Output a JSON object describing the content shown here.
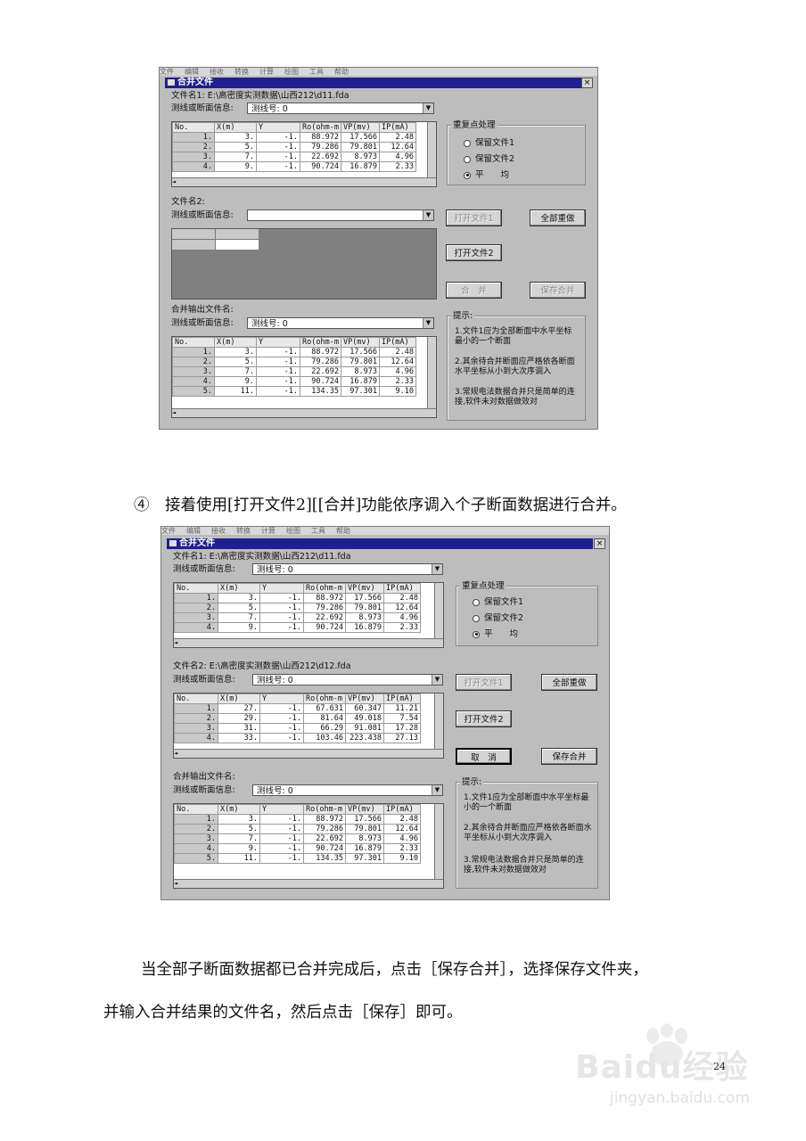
{
  "menu": [
    "文件",
    "编辑",
    "接收",
    "转换",
    "计算",
    "绘图",
    "工具",
    "帮助"
  ],
  "dialog": {
    "title": "合并文件",
    "close": "×",
    "file1_label_a": "文件名1: E:\\高密度实测数据\\山西212\\d11.fda",
    "line_info_label": "测线或断面信息:",
    "line_no": "测线号: 0",
    "file2_label_a": "文件名2:",
    "file2_label_b": "文件名2: E:\\高密度实测数据\\山西212\\d12.fda",
    "output_label": "合并输出文件名:",
    "group_title": "重复点处理",
    "radio_keep1": "保留文件1",
    "radio_keep2": "保留文件2",
    "radio_avg": "平　　均",
    "btn_open1": "打开文件1",
    "btn_redo": "全部重做",
    "btn_open2": "打开文件2",
    "btn_merge": "合　并",
    "btn_cancel": "取　消",
    "btn_save": "保存合并",
    "hint_title": "提示:",
    "hint1": "1.文件1应为全部断面中水平坐标最小的一个断面",
    "hint2": "2.其余待合并断面应严格依各断面水平坐标从小到大次序调入",
    "hint3": "3.常规电法数据合并只是简单的连接,软件未对数据做效对"
  },
  "grid_headers": [
    "No.",
    "X(m)",
    "Y",
    "Ro(ohm-m",
    "VP(mv)",
    "IP(mA)"
  ],
  "grid1_rows": [
    [
      "1.",
      "3.",
      "-1.",
      "88.972",
      "17.566",
      "2.48"
    ],
    [
      "2.",
      "5.",
      "-1.",
      "79.286",
      "79.801",
      "12.64"
    ],
    [
      "3.",
      "7.",
      "-1.",
      "22.692",
      "8.973",
      "4.96"
    ],
    [
      "4.",
      "9.",
      "-1.",
      "90.724",
      "16.879",
      "2.33"
    ]
  ],
  "grid_out_rows_a": [
    [
      "1.",
      "3.",
      "-1.",
      "88.972",
      "17.566",
      "2.48"
    ],
    [
      "2.",
      "5.",
      "-1.",
      "79.286",
      "79.801",
      "12.64"
    ],
    [
      "3.",
      "7.",
      "-1.",
      "22.692",
      "8.973",
      "4.96"
    ],
    [
      "4.",
      "9.",
      "-1.",
      "90.724",
      "16.879",
      "2.33"
    ],
    [
      "5.",
      "11.",
      "-1.",
      "134.35",
      "97.301",
      "9.10"
    ]
  ],
  "grid2_rows": [
    [
      "1.",
      "27.",
      "-1.",
      "67.631",
      "60.347",
      "11.21"
    ],
    [
      "2.",
      "29.",
      "-1.",
      "81.64",
      "49.018",
      "7.54"
    ],
    [
      "3.",
      "31.",
      "-1.",
      "66.29",
      "91.081",
      "17.28"
    ],
    [
      "4.",
      "33.",
      "-1.",
      "103.46",
      "223.438",
      "27.13"
    ]
  ],
  "caption": "④　接着使用[打开文件2][[合并]功能依序调入个子断面数据进行合并。",
  "body_line1": "当全部子断面数据都已合并完成后，点击［保存合并］，选择保存文件夹，",
  "body_line2": "并输入合并结果的文件名，然后点击［保存］即可。",
  "page_number": "24",
  "watermark": {
    "brand": "Baidu经验",
    "url": "jingyan.baidu.com"
  }
}
